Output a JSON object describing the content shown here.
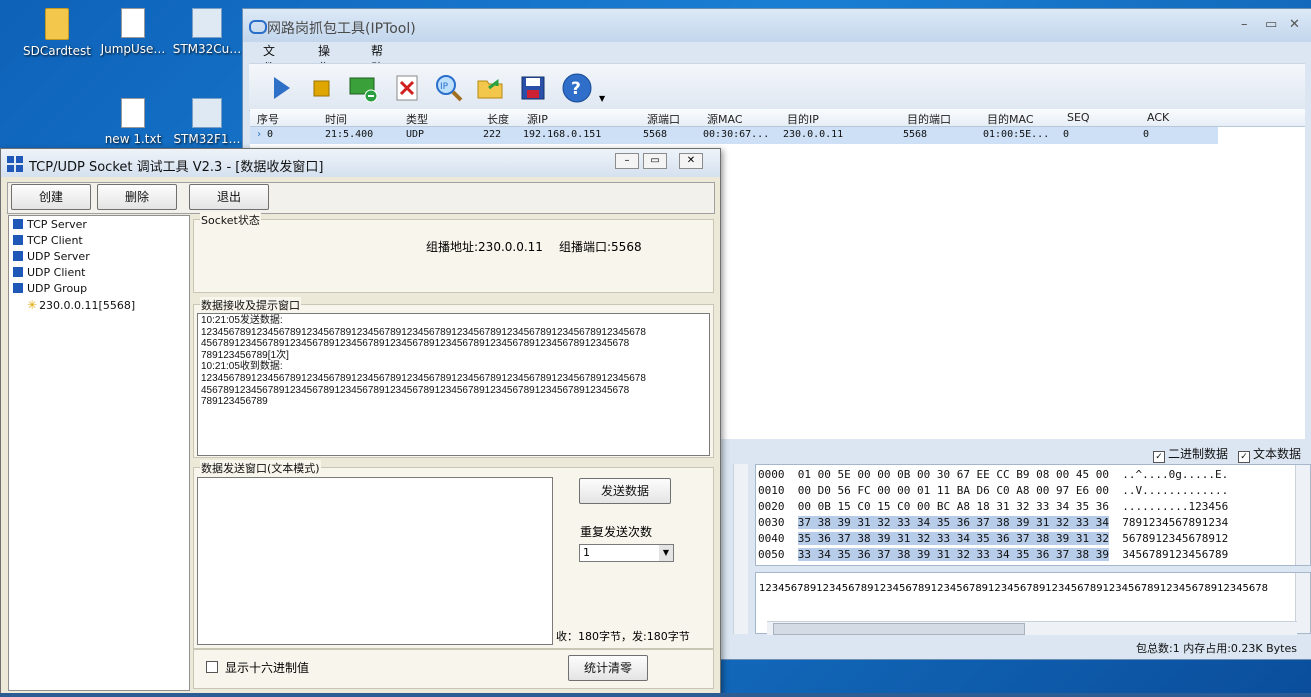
{
  "desktop": {
    "icons": [
      {
        "label": "SDCardtest",
        "icon": "folder-icon"
      },
      {
        "label": "JumpUse…",
        "icon": "document-icon"
      },
      {
        "label": "STM32Cu…",
        "icon": "app-icon"
      },
      {
        "label": "new 1.txt",
        "icon": "document-icon"
      },
      {
        "label": "STM32F1…",
        "icon": "app-icon"
      }
    ]
  },
  "iptool": {
    "title": "网路岗抓包工具(IPTool)",
    "window_controls": {
      "minimize": "–",
      "maximize": "▭",
      "close": "✕"
    },
    "menu": [
      "文件(F)",
      "操作(E)",
      "帮助(H)"
    ],
    "toolbar": [
      "start-icon",
      "stop-icon",
      "network-card-icon",
      "delete-icon",
      "ip-search-icon",
      "open-folder-icon",
      "save-icon",
      "help-icon"
    ],
    "columns": [
      "序号",
      "时间",
      "类型",
      "长度",
      "源IP",
      "源端口",
      "源MAC",
      "目的IP",
      "目的端口",
      "目的MAC",
      "SEQ",
      "ACK"
    ],
    "rows": [
      {
        "no": "0",
        "time": "21:5.400",
        "type": "UDP",
        "len": "222",
        "src_ip": "192.168.0.151",
        "src_port": "5568",
        "src_mac": "00:30:67...",
        "dst_ip": "230.0.0.11",
        "dst_port": "5568",
        "dst_mac": "01:00:5E...",
        "seq": "0",
        "ack": "0"
      }
    ],
    "checks": {
      "binary": "二进制数据",
      "text": "文本数据",
      "binary_checked": true,
      "text_checked": true
    },
    "hex_lines": [
      {
        "off": "0000",
        "bytes": "01 00 5E 00 00 0B 00 30 67 EE CC B9 08 00 45 00",
        "ascii": "..^....0g.....E."
      },
      {
        "off": "0010",
        "bytes": "00 D0 56 FC 00 00 01 11 BA D6 C0 A8 00 97 E6 00",
        "ascii": "..V............."
      },
      {
        "off": "0020",
        "bytes": "00 0B 15 C0 15 C0 00 BC A8 18 31 32 33 34 35 36",
        "ascii": "..........123456"
      },
      {
        "off": "0030",
        "bytes": "37 38 39 31 32 33 34 35 36 37 38 39 31 32 33 34",
        "ascii": "7891234567891234"
      },
      {
        "off": "0040",
        "bytes": "35 36 37 38 39 31 32 33 34 35 36 37 38 39 31 32",
        "ascii": "5678912345678912"
      },
      {
        "off": "0050",
        "bytes": "33 34 35 36 37 38 39 31 32 33 34 35 36 37 38 39",
        "ascii": "3456789123456789"
      }
    ],
    "text_data": "12345678912345678912345678912345678912345678912345678912345678912345678912345678",
    "status": "包总数:1  内存占用:0.23K Bytes"
  },
  "socket": {
    "title": "TCP/UDP Socket 调试工具 V2.3 - [数据收发窗口]",
    "buttons": {
      "create": "创建",
      "delete": "删除",
      "exit": "退出"
    },
    "tree": [
      "TCP Server",
      "TCP Client",
      "UDP Server",
      "UDP Client",
      "UDP Group",
      "230.0.0.11[5568]"
    ],
    "state_label": "Socket状态",
    "group_addr": "组播地址:230.0.0.11",
    "group_port": "组播端口:5568",
    "recv_label": "数据接收及提示窗口",
    "recv_text": "10:21:05发送数据:\n12345678912345678912345678912345678912345678912345678912345678912345678912345678\n45678912345678912345678912345678912345678912345678912345678912345678912345678\n789123456789[1次]\n10:21:05收到数据:\n12345678912345678912345678912345678912345678912345678912345678912345678912345678\n45678912345678912345678912345678912345678912345678912345678912345678912345678\n789123456789",
    "send_label": "数据发送窗口(文本模式)",
    "send_button": "发送数据",
    "repeat_label": "重复发送次数",
    "repeat_value": "1",
    "counter": "收：180字节，发:180字节",
    "hex_checkbox": "显示十六进制值",
    "clear_button": "统计清零"
  }
}
